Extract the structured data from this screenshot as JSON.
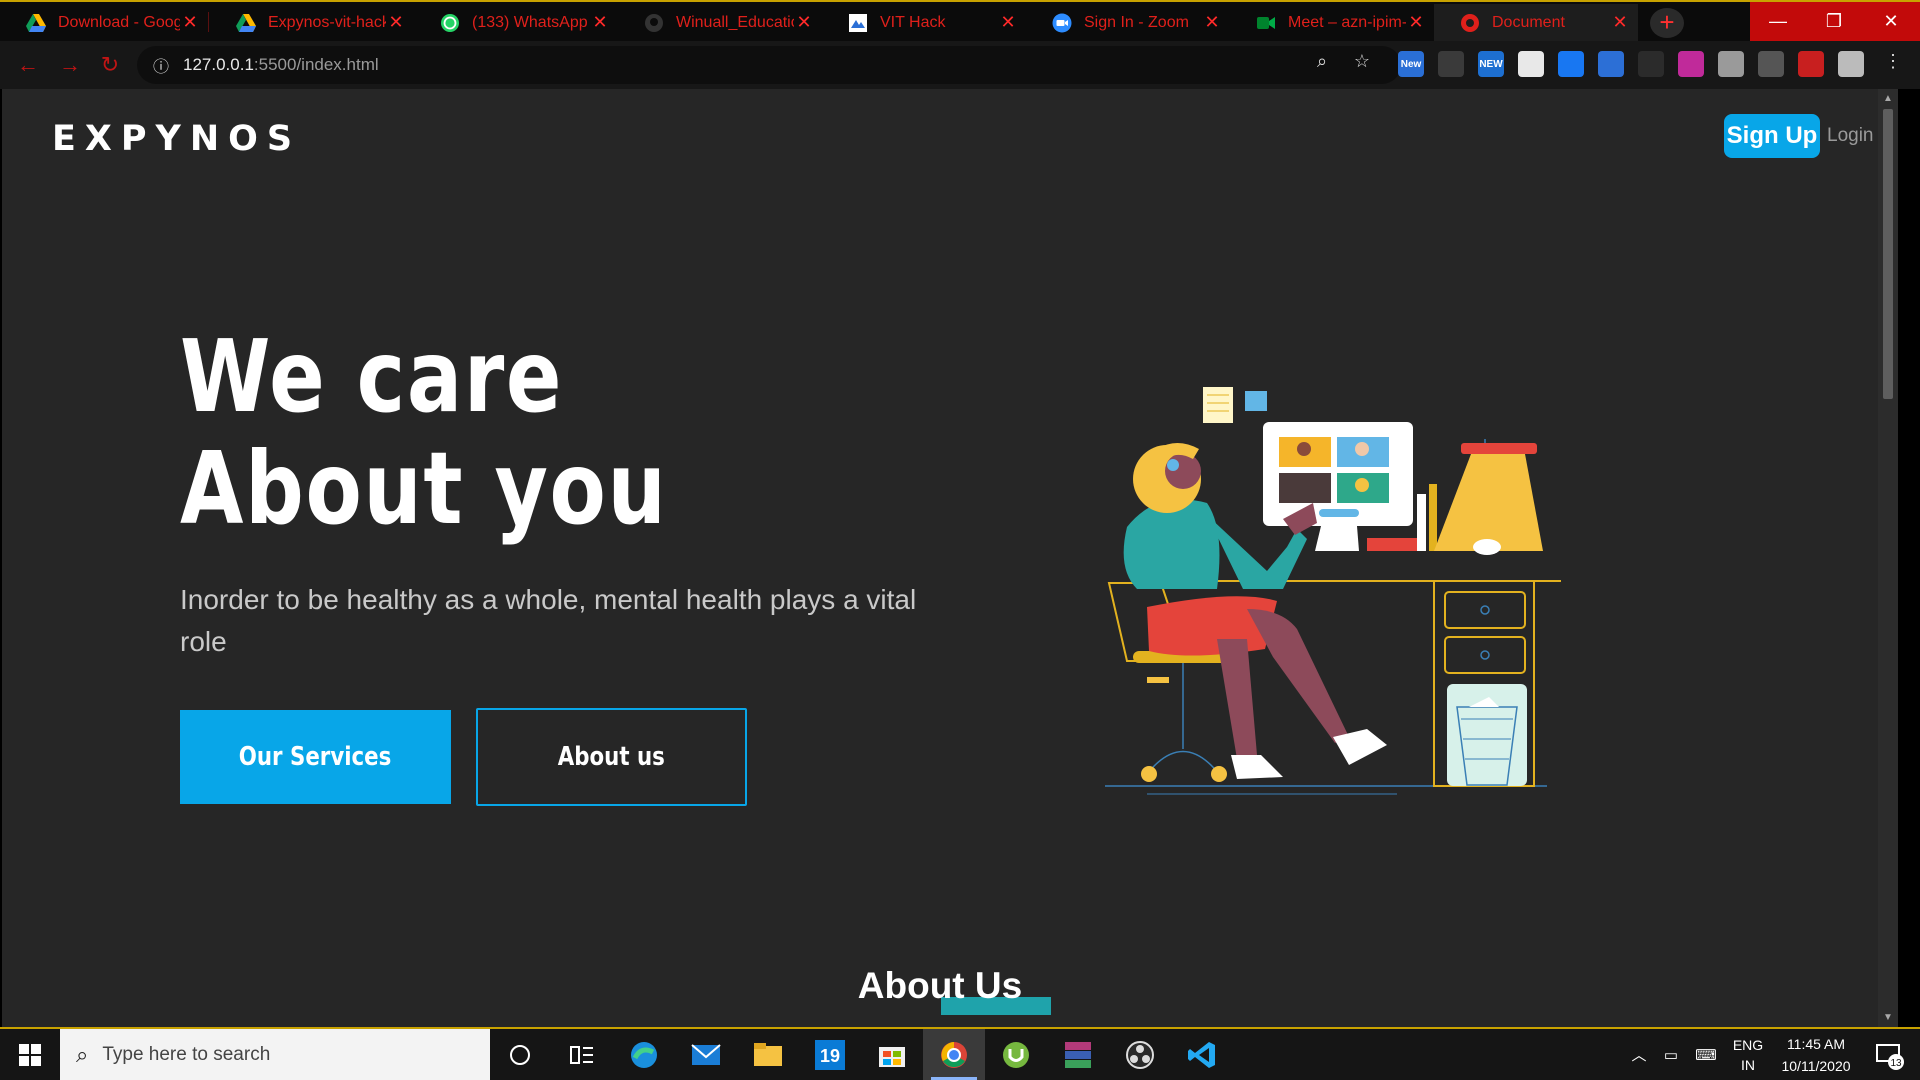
{
  "browser": {
    "tabs": [
      {
        "title": "Download - Google",
        "icon": "google-drive-icon"
      },
      {
        "title": "Expynos-vit-hack",
        "icon": "google-drive-icon"
      },
      {
        "title": "(133) WhatsApp",
        "icon": "whatsapp-icon"
      },
      {
        "title": "Winuall_Education",
        "icon": "github-icon"
      },
      {
        "title": "VIT Hack",
        "icon": "vithack-icon"
      },
      {
        "title": "Sign In - Zoom",
        "icon": "zoom-icon"
      },
      {
        "title": "Meet – azn-ipim-t",
        "icon": "google-meet-icon"
      },
      {
        "title": "Document",
        "icon": "chrome-icon"
      }
    ],
    "new_tab_label": "+",
    "window_controls": {
      "minimize": "—",
      "restore": "❐",
      "close": "✕"
    },
    "url_host": "127.0.0.1",
    "url_rest": ":5500/index.html",
    "extensions": [
      {
        "label": "New",
        "color": "#2a6fd6"
      },
      {
        "label": "",
        "color": "#3a3a3a"
      },
      {
        "label": "NEW",
        "color": "#1d6fd1"
      },
      {
        "label": "",
        "color": "#e8e8e8"
      },
      {
        "label": "",
        "color": "#1877f2"
      },
      {
        "label": "",
        "color": "#2c6fd6"
      },
      {
        "label": "",
        "color": "#2b2b2b"
      },
      {
        "label": "",
        "color": "#c02a9a"
      },
      {
        "label": "",
        "color": "#9a9a9a"
      },
      {
        "label": "",
        "color": "#555555"
      },
      {
        "label": "",
        "color": "#c81f1f"
      },
      {
        "label": "",
        "color": "#bbbbbb"
      }
    ]
  },
  "site": {
    "logo": "EXPYNOS",
    "signup_label": "Sign Up",
    "login_label": "Login",
    "hero_line1": "We care",
    "hero_line2": "About you",
    "hero_subtitle": "Inorder to be healthy as a whole, mental health plays a vital role",
    "btn_services": "Our Services",
    "btn_about": "About us",
    "about_heading": "About Us",
    "accent_color": "#08a6e8"
  },
  "taskbar": {
    "search_placeholder": "Type here to search",
    "calendar_badge": "19",
    "lang_top": "ENG",
    "lang_bottom": "IN",
    "time": "11:45 AM",
    "date": "10/11/2020",
    "notification_count": "13"
  }
}
